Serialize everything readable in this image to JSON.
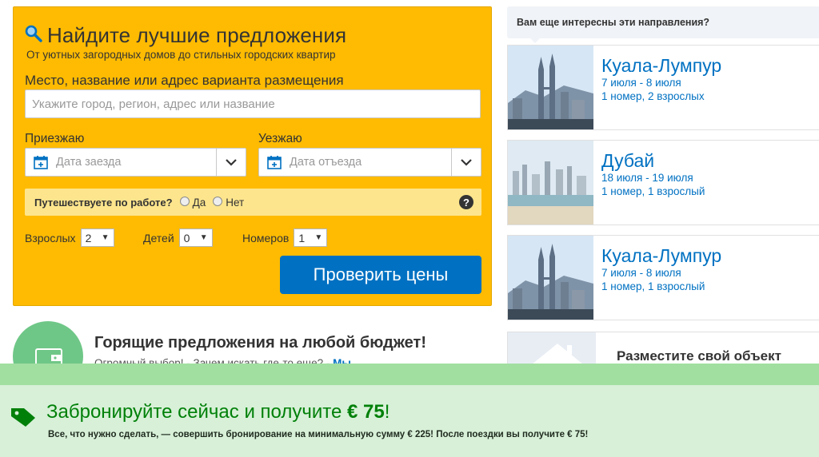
{
  "search": {
    "title": "Найдите лучшие предложения",
    "subtitle": "От уютных загородных домов до стильных городских квартир",
    "destination_label": "Место, название или адрес варианта размещения",
    "destination_placeholder": "Укажите город, регион, адрес или название",
    "checkin_label": "Приезжаю",
    "checkin_placeholder": "Дата заезда",
    "checkout_label": "Уезжаю",
    "checkout_placeholder": "Дата отъезда",
    "work_question": "Путешествуете по работе?",
    "work_yes": "Да",
    "work_no": "Нет",
    "help": "?",
    "adults_label": "Взрослых",
    "adults_value": "2",
    "children_label": "Детей",
    "children_value": "0",
    "rooms_label": "Номеров",
    "rooms_value": "1",
    "submit_label": "Проверить цены"
  },
  "promo": {
    "title": "Горящие предложения на любой бюджет!",
    "subtitle": "Огромный выбор! - Зачем искать где-то еще? -",
    "subtitle_link": "Мы"
  },
  "interests": {
    "title": "Вам еще интересны эти направления?",
    "items": [
      {
        "city": "Куала-Лумпур",
        "dates": "7 июля - 8 июля",
        "guests": "1 номер, 2 взрослых"
      },
      {
        "city": "Дубай",
        "dates": "18 июля - 19 июля",
        "guests": "1 номер, 1 взрослый"
      },
      {
        "city": "Куала-Лумпур",
        "dates": "7 июля - 8 июля",
        "guests": "1 номер, 1 взрослый"
      }
    ]
  },
  "list_property": {
    "title": "Разместите свой объект"
  },
  "banner": {
    "headline_prefix": "Забронируйте сейчас и получите",
    "headline_amount": "€ 75",
    "headline_suffix": "!",
    "text": "Все, что нужно сделать, — совершить бронирование на минимальную сумму € 225! После поездки вы получите € 75!"
  },
  "colors": {
    "accent_yellow": "#febb02",
    "brand_blue": "#0071c2",
    "promo_green": "#008009"
  }
}
